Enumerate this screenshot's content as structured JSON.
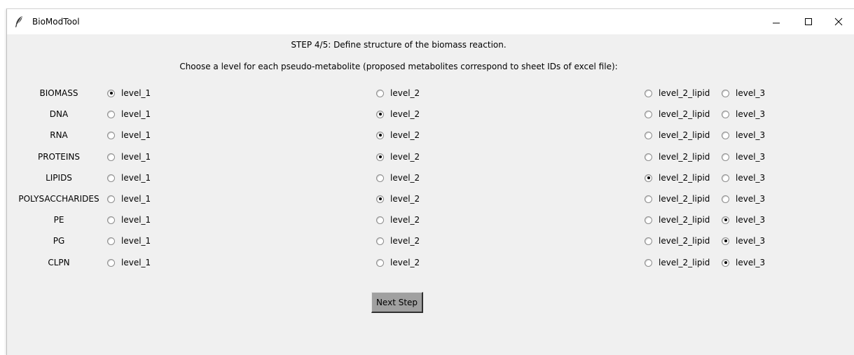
{
  "window": {
    "title": "BioModTool",
    "controls": [
      "minimize-icon",
      "maximize-icon",
      "close-icon"
    ]
  },
  "header": {
    "step": "STEP 4/5: Define structure of the biomass reaction.",
    "instruction": "Choose a level for each pseudo-metabolite (proposed metabolites correspond to sheet IDs of excel file):"
  },
  "options": [
    "level_1",
    "level_2",
    "level_2_lipid",
    "level_3"
  ],
  "rows": [
    {
      "name": "BIOMASS",
      "selected": "level_1"
    },
    {
      "name": "DNA",
      "selected": "level_2"
    },
    {
      "name": "RNA",
      "selected": "level_2"
    },
    {
      "name": "PROTEINS",
      "selected": "level_2"
    },
    {
      "name": "LIPIDS",
      "selected": "level_2_lipid"
    },
    {
      "name": "POLYSACCHARIDES",
      "selected": "level_2"
    },
    {
      "name": "PE",
      "selected": "level_3"
    },
    {
      "name": "PG",
      "selected": "level_3"
    },
    {
      "name": "CLPN",
      "selected": "level_3"
    }
  ],
  "actions": {
    "next_label": "Next Step"
  }
}
